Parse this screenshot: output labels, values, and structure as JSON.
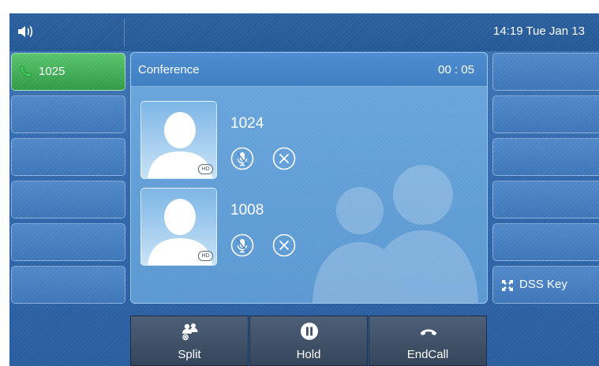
{
  "status_bar": {
    "datetime": "14:19 Tue Jan 13",
    "speaker_icon": "speaker-icon"
  },
  "left_keys": [
    {
      "label": "1025",
      "icon": "phone-handset-icon",
      "active": true
    },
    {
      "label": ""
    },
    {
      "label": ""
    },
    {
      "label": ""
    },
    {
      "label": ""
    },
    {
      "label": ""
    }
  ],
  "right_keys": [
    {
      "label": ""
    },
    {
      "label": ""
    },
    {
      "label": ""
    },
    {
      "label": ""
    },
    {
      "label": ""
    },
    {
      "label": "DSS Key",
      "icon": "dss-key-icon"
    }
  ],
  "conference": {
    "title": "Conference",
    "timer": "00 : 05",
    "participants": [
      {
        "number": "1024",
        "badge": "HD",
        "icons": [
          "mute-mic-icon",
          "remove-icon"
        ]
      },
      {
        "number": "1008",
        "badge": "HD",
        "icons": [
          "mute-mic-icon",
          "remove-icon"
        ]
      }
    ]
  },
  "softkeys": [
    {
      "label": "Split",
      "icon": "split-icon"
    },
    {
      "label": "Hold",
      "icon": "pause-icon"
    },
    {
      "label": "EndCall",
      "icon": "end-call-icon"
    }
  ],
  "colors": {
    "active_line": "#3faa55",
    "screen_blue": "#2f67ab",
    "panel_blue": "#5b98d1",
    "softkey_grey": "#3f5068"
  }
}
